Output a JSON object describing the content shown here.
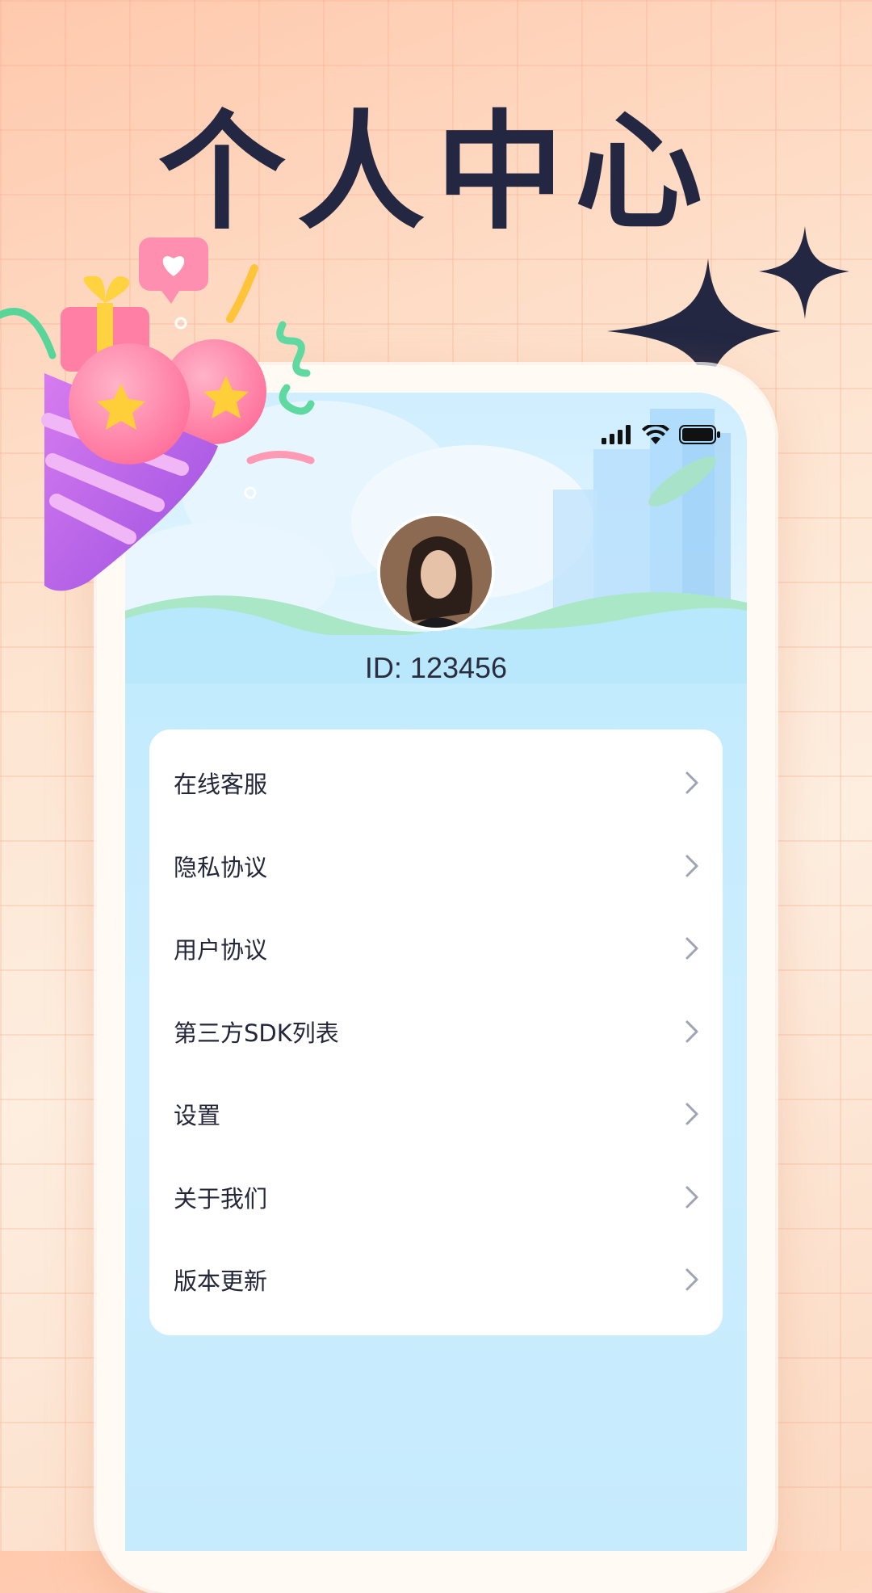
{
  "banner": {
    "title": "个人中心"
  },
  "status_bar": {
    "icons": [
      "signal-icon",
      "wifi-icon",
      "battery-icon"
    ]
  },
  "profile": {
    "id_text": "ID: 123456"
  },
  "menu": {
    "items": [
      {
        "label": "在线客服"
      },
      {
        "label": "隐私协议"
      },
      {
        "label": "用户协议"
      },
      {
        "label": "第三方SDK列表"
      },
      {
        "label": "设置"
      },
      {
        "label": "关于我们"
      },
      {
        "label": "版本更新"
      }
    ]
  },
  "colors": {
    "headline": "#232741",
    "accent_sky": "#b9e8fd",
    "text": "#24273a"
  }
}
